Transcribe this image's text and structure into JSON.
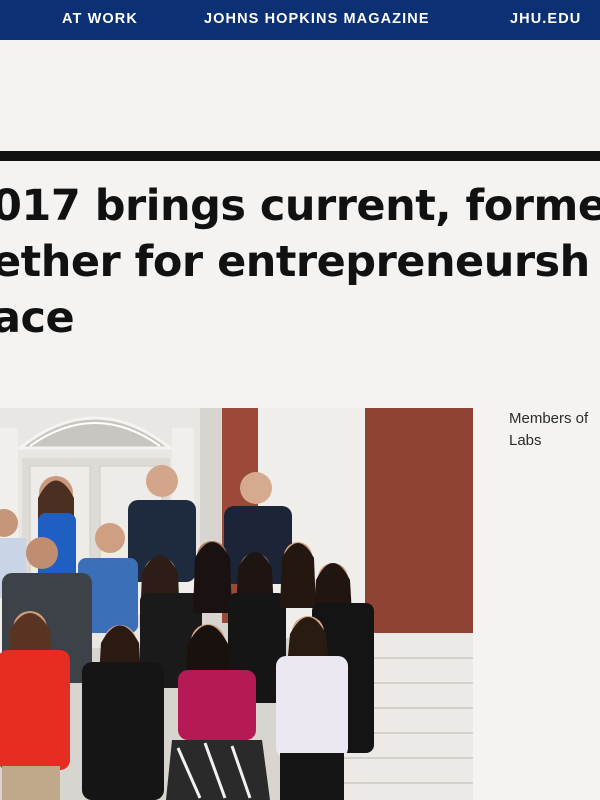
{
  "nav": {
    "items": [
      {
        "label": "AT WORK"
      },
      {
        "label": "JOHNS HOPKINS MAGAZINE"
      },
      {
        "label": "JHU.EDU"
      }
    ]
  },
  "article": {
    "headline_lines": [
      "017 brings current, forme",
      "ether for entrepreneursh",
      "ace"
    ]
  },
  "photo": {
    "caption_lines": [
      "Members of",
      "Labs"
    ]
  },
  "colors": {
    "nav_background": "#0b3074",
    "page_background": "#f4f3f1",
    "rule": "#111111"
  }
}
